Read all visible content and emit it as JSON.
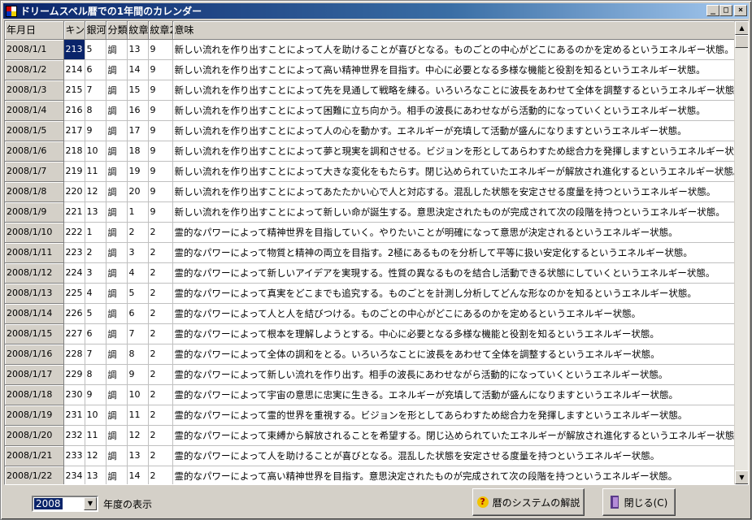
{
  "window": {
    "title": "ドリームスペル暦での1年間のカレンダー",
    "buttons": {
      "minimize": "_",
      "maximize": "□",
      "close": "×"
    }
  },
  "grid": {
    "columns": [
      "年月日",
      "キン",
      "銀河",
      "分類",
      "紋章",
      "紋章2",
      "意味"
    ],
    "selected_cell": {
      "row": 0,
      "column": 1
    },
    "rows": [
      [
        "2008/1/1",
        "213",
        "5",
        "調",
        "13",
        "9",
        "新しい流れを作り出すことによって人を助けることが喜びとなる。ものごとの中心がどこにあるのかを定めるというエネルギー状態。"
      ],
      [
        "2008/1/2",
        "214",
        "6",
        "調",
        "14",
        "9",
        "新しい流れを作り出すことによって高い精神世界を目指す。中心に必要となる多様な機能と役割を知るというエネルギー状態。"
      ],
      [
        "2008/1/3",
        "215",
        "7",
        "調",
        "15",
        "9",
        "新しい流れを作り出すことによって先を見通して戦略を練る。いろいろなことに波長をあわせて全体を調整するというエネルギー状態。"
      ],
      [
        "2008/1/4",
        "216",
        "8",
        "調",
        "16",
        "9",
        "新しい流れを作り出すことによって困難に立ち向かう。相手の波長にあわせながら活動的になっていくというエネルギー状態。"
      ],
      [
        "2008/1/5",
        "217",
        "9",
        "調",
        "17",
        "9",
        "新しい流れを作り出すことによって人の心を動かす。エネルギーが充填して活動が盛んになりますというエネルギー状態。"
      ],
      [
        "2008/1/6",
        "218",
        "10",
        "調",
        "18",
        "9",
        "新しい流れを作り出すことによって夢と現実を調和させる。ビジョンを形としてあらわすため総合力を発揮しますというエネルギー状態。"
      ],
      [
        "2008/1/7",
        "219",
        "11",
        "調",
        "19",
        "9",
        "新しい流れを作り出すことによって大きな変化をもたらす。閉じ込められていたエネルギーが解放され進化するというエネルギー状態。"
      ],
      [
        "2008/1/8",
        "220",
        "12",
        "調",
        "20",
        "9",
        "新しい流れを作り出すことによってあたたかい心で人と対応する。混乱した状態を安定させる度量を持つというエネルギー状態。"
      ],
      [
        "2008/1/9",
        "221",
        "13",
        "調",
        "1",
        "9",
        "新しい流れを作り出すことによって新しい命が誕生する。意思決定されたものが完成されて次の段階を持つというエネルギー状態。"
      ],
      [
        "2008/1/10",
        "222",
        "1",
        "調",
        "2",
        "2",
        "霊的なパワーによって精神世界を目指していく。やりたいことが明確になって意思が決定されるというエネルギー状態。"
      ],
      [
        "2008/1/11",
        "223",
        "2",
        "調",
        "3",
        "2",
        "霊的なパワーによって物質と精神の両立を目指す。2極にあるものを分析して平等に扱い安定化するというエネルギー状態。"
      ],
      [
        "2008/1/12",
        "224",
        "3",
        "調",
        "4",
        "2",
        "霊的なパワーによって新しいアイデアを実現する。性質の異なるものを結合し活動できる状態にしていくというエネルギー状態。"
      ],
      [
        "2008/1/13",
        "225",
        "4",
        "調",
        "5",
        "2",
        "霊的なパワーによって真実をどこまでも追究する。ものごとを計測し分析してどんな形なのかを知るというエネルギー状態。"
      ],
      [
        "2008/1/14",
        "226",
        "5",
        "調",
        "6",
        "2",
        "霊的なパワーによって人と人を結びつける。ものごとの中心がどこにあるのかを定めるというエネルギー状態。"
      ],
      [
        "2008/1/15",
        "227",
        "6",
        "調",
        "7",
        "2",
        "霊的なパワーによって根本を理解しようとする。中心に必要となる多様な機能と役割を知るというエネルギー状態。"
      ],
      [
        "2008/1/16",
        "228",
        "7",
        "調",
        "8",
        "2",
        "霊的なパワーによって全体の調和をとる。いろいろなことに波長をあわせて全体を調整するというエネルギー状態。"
      ],
      [
        "2008/1/17",
        "229",
        "8",
        "調",
        "9",
        "2",
        "霊的なパワーによって新しい流れを作り出す。相手の波長にあわせながら活動的になっていくというエネルギー状態。"
      ],
      [
        "2008/1/18",
        "230",
        "9",
        "調",
        "10",
        "2",
        "霊的なパワーによって宇宙の意思に忠実に生きる。エネルギーが充填して活動が盛んになりますというエネルギー状態。"
      ],
      [
        "2008/1/19",
        "231",
        "10",
        "調",
        "11",
        "2",
        "霊的なパワーによって霊的世界を重視する。ビジョンを形としてあらわすため総合力を発揮しますというエネルギー状態。"
      ],
      [
        "2008/1/20",
        "232",
        "11",
        "調",
        "12",
        "2",
        "霊的なパワーによって束縛から解放されることを希望する。閉じ込められていたエネルギーが解放され進化するというエネルギー状態。"
      ],
      [
        "2008/1/21",
        "233",
        "12",
        "調",
        "13",
        "2",
        "霊的なパワーによって人を助けることが喜びとなる。混乱した状態を安定させる度量を持つというエネルギー状態。"
      ],
      [
        "2008/1/22",
        "234",
        "13",
        "調",
        "14",
        "2",
        "霊的なパワーによって高い精神世界を目指す。意思決定されたものが完成されて次の段階を持つというエネルギー状態。"
      ]
    ]
  },
  "footer": {
    "year_value": "2008",
    "year_label": "年度の表示",
    "help_button": "暦のシステムの解説",
    "close_button": "閉じる(C)"
  },
  "colors": {
    "titlebar_start": "#0a246a",
    "selection": "#0a246a",
    "face": "#d4d0c8",
    "help_icon": "#f2c300",
    "door_icon": "#5a3a8a"
  },
  "icons": {
    "app": "dreamspell-app-icon",
    "help": "question-mark-icon",
    "close": "door-exit-icon"
  }
}
